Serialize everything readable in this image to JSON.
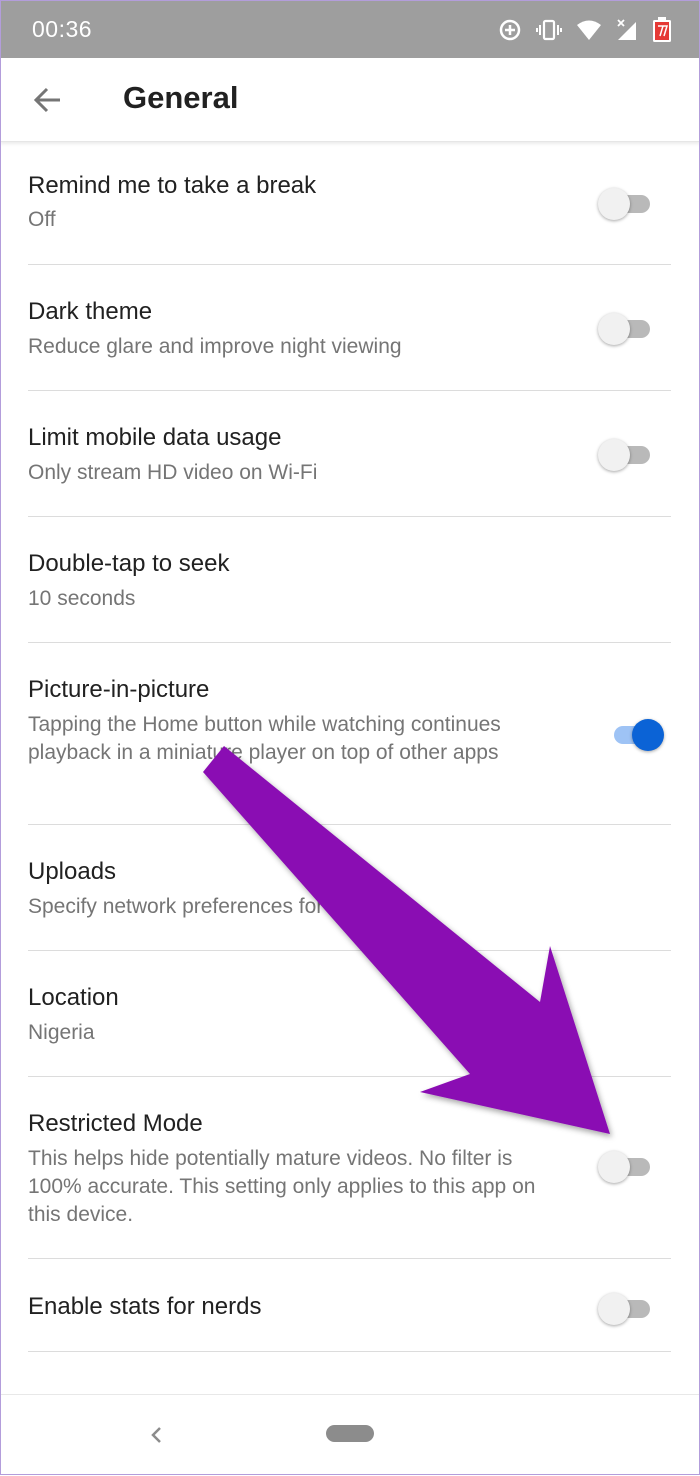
{
  "status_bar": {
    "time": "00:36",
    "icons": [
      "data-saver-icon",
      "vibrate-icon",
      "wifi-icon",
      "signal-icon",
      "battery-icon"
    ]
  },
  "app_bar": {
    "title": "General"
  },
  "settings": [
    {
      "title": "Remind me to take a break",
      "subtitle": "Off",
      "toggle": true,
      "enabled": false
    },
    {
      "title": "Dark theme",
      "subtitle": "Reduce glare and improve night viewing",
      "toggle": true,
      "enabled": false
    },
    {
      "title": "Limit mobile data usage",
      "subtitle": "Only stream HD video on Wi-Fi",
      "toggle": true,
      "enabled": false
    },
    {
      "title": "Double-tap to seek",
      "subtitle": "10 seconds",
      "toggle": false
    },
    {
      "title": "Picture-in-picture",
      "subtitle": "Tapping the Home button while watching continues playback in a miniature player on top of other apps",
      "toggle": true,
      "enabled": true
    },
    {
      "title": "Uploads",
      "subtitle": "Specify network preferences for uploads",
      "toggle": false
    },
    {
      "title": "Location",
      "subtitle": "Nigeria",
      "toggle": false
    },
    {
      "title": "Restricted Mode",
      "subtitle": "This helps hide potentially mature videos. No filter is 100% accurate. This setting only applies to this app on this device.",
      "toggle": true,
      "enabled": false
    },
    {
      "title": "Enable stats for nerds",
      "subtitle": "",
      "toggle": true,
      "enabled": false
    }
  ],
  "colors": {
    "accent": "#0b63d6",
    "annotation_arrow": "#8a0cb3",
    "status_bar": "#9e9e9e"
  }
}
